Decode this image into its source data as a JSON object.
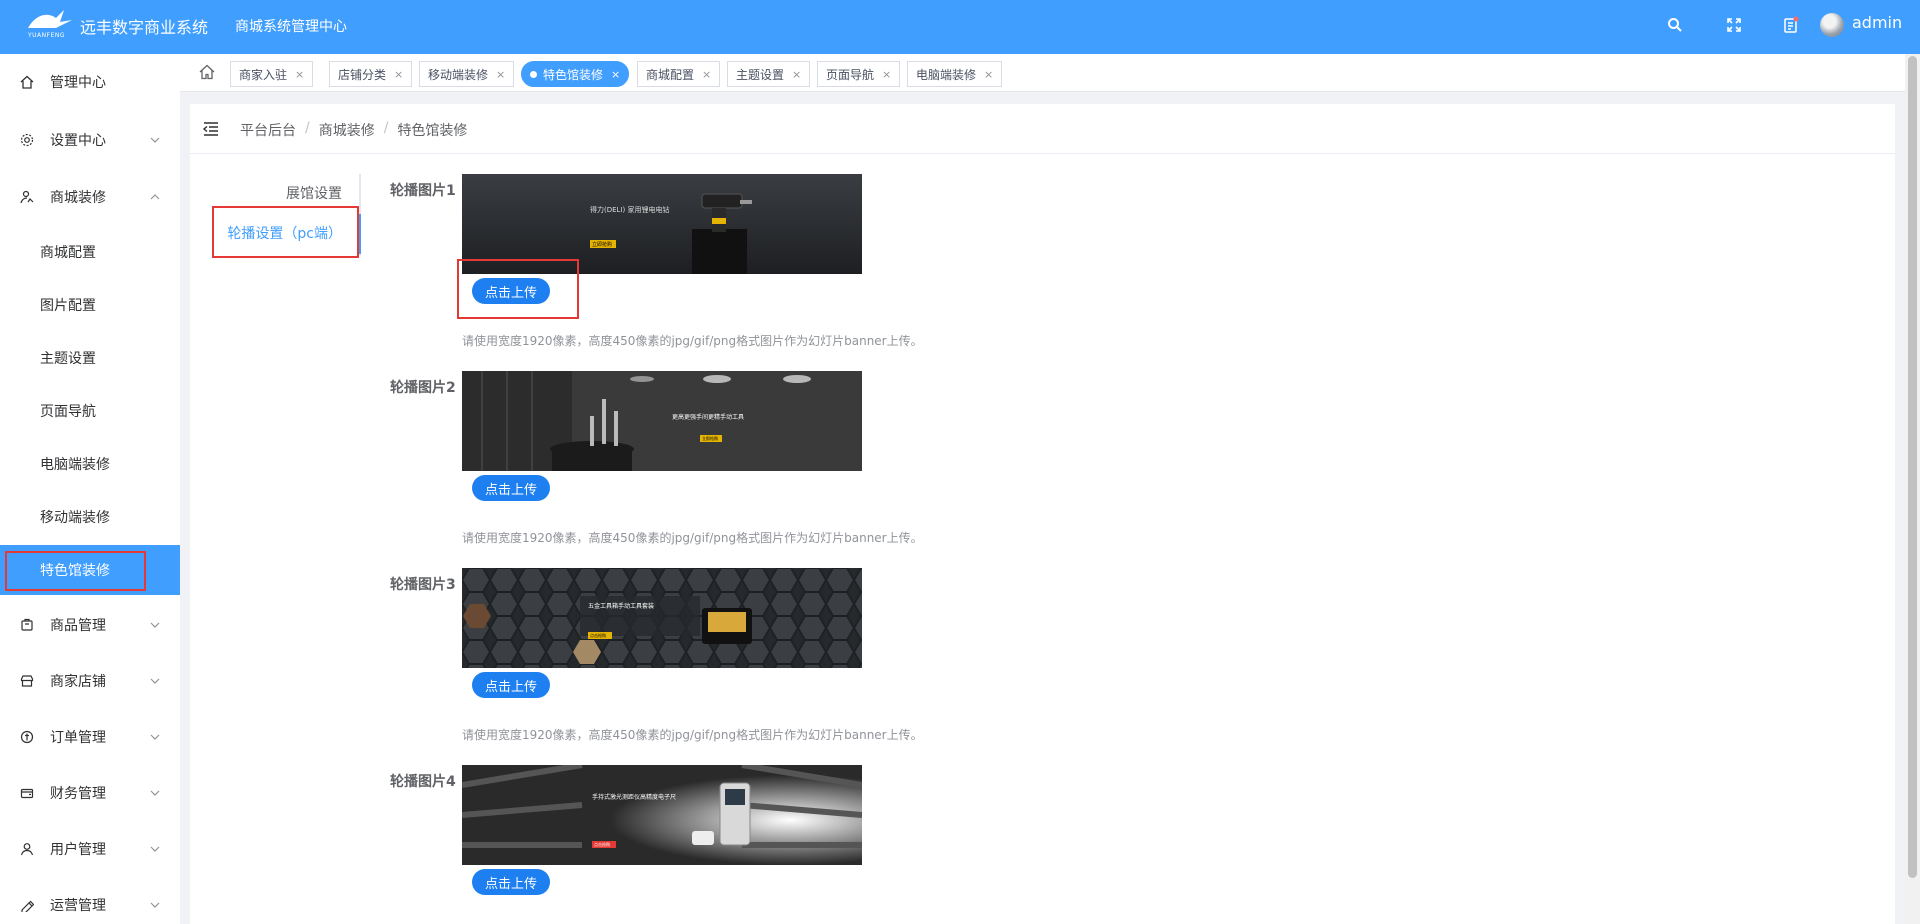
{
  "header": {
    "logo_text": "YUANFENG",
    "brand": "远丰数字商业系统",
    "subtitle": "商城系统管理中心",
    "username": "admin",
    "icons": [
      "search-icon",
      "fullscreen-icon",
      "notification-icon"
    ]
  },
  "sidebar": {
    "items": [
      {
        "label": "管理中心",
        "icon": "home-icon"
      },
      {
        "label": "设置中心",
        "icon": "gear-icon"
      },
      {
        "label": "商城装修",
        "icon": "decoration-icon"
      },
      {
        "label": "商品管理",
        "icon": "goods-icon"
      },
      {
        "label": "商家店铺",
        "icon": "shop-icon"
      },
      {
        "label": "订单管理",
        "icon": "order-icon"
      },
      {
        "label": "财务管理",
        "icon": "finance-icon"
      },
      {
        "label": "用户管理",
        "icon": "user-icon"
      },
      {
        "label": "运营管理",
        "icon": "operation-icon"
      }
    ],
    "subitems": [
      "商城配置",
      "图片配置",
      "主题设置",
      "页面导航",
      "电脑端装修",
      "移动端装修",
      "特色馆装修"
    ],
    "active_subitem": "特色馆装修"
  },
  "tags": [
    {
      "label": "商家入驻"
    },
    {
      "label": "店铺分类"
    },
    {
      "label": "移动端装修"
    },
    {
      "label": "特色馆装修",
      "active": true
    },
    {
      "label": "商城配置"
    },
    {
      "label": "主题设置"
    },
    {
      "label": "页面导航"
    },
    {
      "label": "电脑端装修"
    }
  ],
  "breadcrumb": [
    "平台后台",
    "商城装修",
    "特色馆装修"
  ],
  "vtabs": [
    "展馆设置",
    "轮播设置（pc端）"
  ],
  "slides": [
    {
      "label": "轮播图片1",
      "button": "点击上传",
      "hint": "请使用宽度1920像素，高度450像素的jpg/gif/png格式图片作为幻灯片banner上传。",
      "banner_title": "得力(DELI) 家用锂电电钻",
      "banner_tag": "立即抢购"
    },
    {
      "label": "轮播图片2",
      "button": "点击上传",
      "hint": "请使用宽度1920像素，高度450像素的jpg/gif/png格式图片作为幻灯片banner上传。",
      "banner_title": "更高更强手间更精手动工具",
      "banner_tag": "立即抢购"
    },
    {
      "label": "轮播图片3",
      "button": "点击上传",
      "hint": "请使用宽度1920像素，高度450像素的jpg/gif/png格式图片作为幻灯片banner上传。",
      "banner_title": "五金工具箱手动工具套装",
      "banner_tag": "点击抢购"
    },
    {
      "label": "轮播图片4",
      "button": "点击上传",
      "hint": "",
      "banner_title": "手持式激光测距仪高精度电子尺",
      "banner_tag": "点击抢购"
    }
  ],
  "colors": {
    "primary": "#409eff",
    "button": "#1e7ff0",
    "highlight": "#e53935"
  }
}
